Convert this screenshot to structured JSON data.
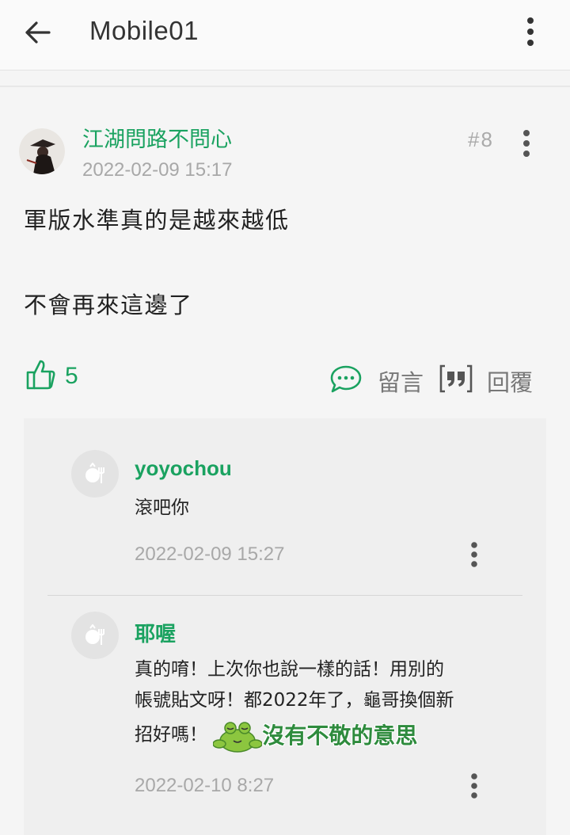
{
  "app": {
    "title": "Mobile01"
  },
  "post": {
    "author": "江湖問路不問心",
    "date": "2022-02-09 15:17",
    "floor": "#8",
    "lines": [
      "軍版水準真的是越來越低",
      "不會再來這邊了"
    ],
    "like_count": "5",
    "comment_label": "留言",
    "reply_label": "回覆"
  },
  "comments": [
    {
      "name": "yoyochou",
      "text": "滾吧你",
      "date": "2022-02-09 15:27"
    },
    {
      "name": "耶喔",
      "text_lines": [
        "真的唷！上次你也說一樣的話！用別的",
        "帳號貼文呀！都2022年了，龜哥換個新",
        "招好嗎！"
      ],
      "sticker_text": "沒有不敬的意思",
      "date": "2022-02-10 8:27"
    }
  ],
  "colors": {
    "accent": "#1aa260",
    "muted": "#a8a8a8"
  },
  "icons": [
    "back-arrow-icon",
    "more-vert-icon",
    "thumbs-up-icon",
    "chat-bubble-icon",
    "quote-icon",
    "user-placeholder-icon"
  ]
}
